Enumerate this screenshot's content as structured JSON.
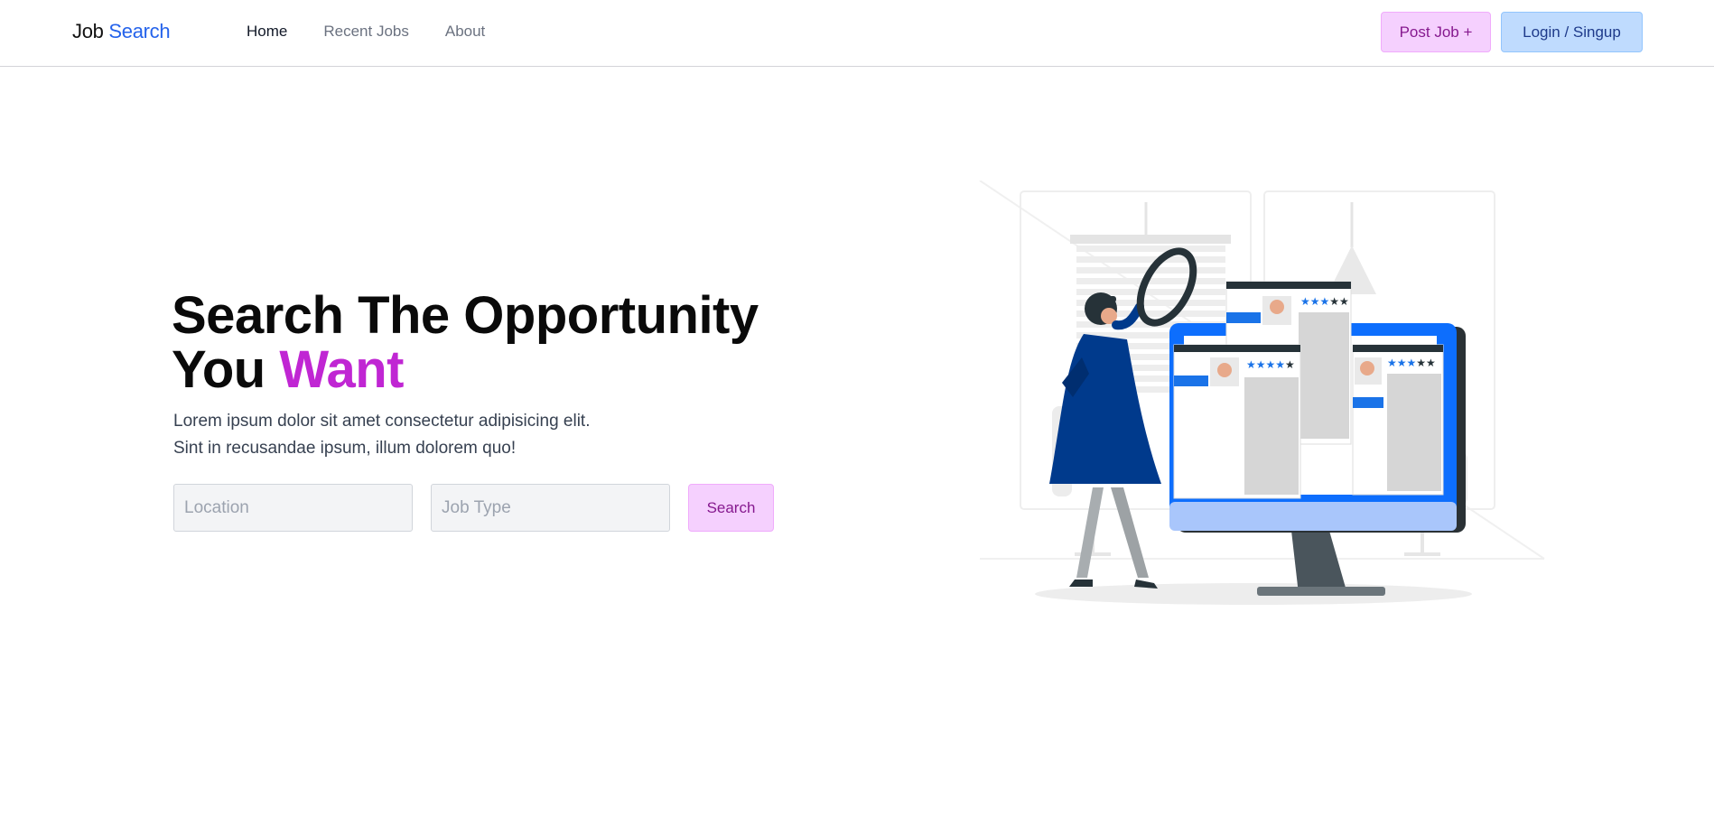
{
  "brand": {
    "part1": "Job",
    "part2": "Search",
    "accent_color": "#2563eb"
  },
  "nav": [
    {
      "label": "Home",
      "active": true
    },
    {
      "label": "Recent Jobs",
      "active": false
    },
    {
      "label": "About",
      "active": false
    }
  ],
  "header_actions": {
    "post_label": "Post Job +",
    "login_label": "Login / Singup"
  },
  "hero": {
    "title_line1": "Search The Opportunity",
    "title_line2_prefix": "You",
    "title_line2_accent": "Want",
    "accent_color": "#c026d3",
    "desc_line1": "Lorem ipsum dolor sit amet consectetur adipisicing elit.",
    "desc_line2": "Sint in recusandae ipsum, illum dolorem quo!"
  },
  "search": {
    "location_placeholder": "Location",
    "location_value": "",
    "type_placeholder": "Job Type",
    "type_value": "",
    "button_label": "Search"
  },
  "illustration": {
    "name": "job-search-illustration",
    "ratings": [
      "3 of 5 stars",
      "4 of 5 stars",
      "3 of 5 stars"
    ]
  }
}
